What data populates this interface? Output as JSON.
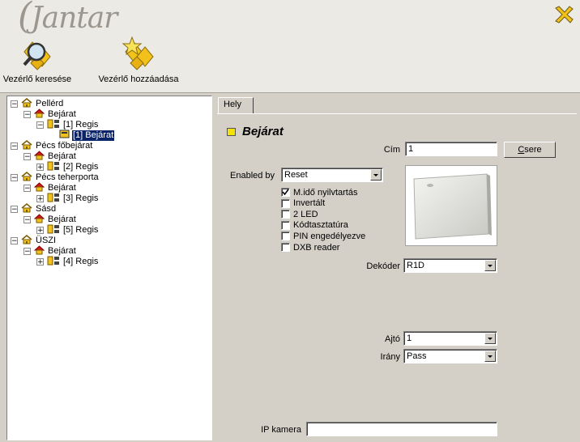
{
  "app": {
    "logo_text": "Jantar"
  },
  "toolbar": {
    "search_label": "Vezérlő keresése",
    "add_label": "Vezérlő hozzáadása"
  },
  "tree": [
    {
      "label": "Pellérd",
      "type": "site",
      "level": 0,
      "expander": "−"
    },
    {
      "label": "Bejárat",
      "type": "home",
      "level": 1,
      "expander": "−"
    },
    {
      "label": "[1] Regis",
      "type": "controller",
      "level": 2,
      "expander": "−"
    },
    {
      "label": "[1] Bejárat",
      "type": "reader",
      "level": 3,
      "expander": "",
      "selected": true
    },
    {
      "label": "Pécs főbejárat",
      "type": "site",
      "level": 0,
      "expander": "−"
    },
    {
      "label": "Bejárat",
      "type": "home",
      "level": 1,
      "expander": "−"
    },
    {
      "label": "[2] Regis",
      "type": "controller",
      "level": 2,
      "expander": "+"
    },
    {
      "label": "Pécs teherporta",
      "type": "site",
      "level": 0,
      "expander": "−"
    },
    {
      "label": "Bejárat",
      "type": "home",
      "level": 1,
      "expander": "−"
    },
    {
      "label": "[3] Regis",
      "type": "controller",
      "level": 2,
      "expander": "+"
    },
    {
      "label": "Sásd",
      "type": "site",
      "level": 0,
      "expander": "−"
    },
    {
      "label": "Bejárat",
      "type": "home",
      "level": 1,
      "expander": "−"
    },
    {
      "label": "[5] Regis",
      "type": "controller",
      "level": 2,
      "expander": "+"
    },
    {
      "label": "ÜSZI",
      "type": "site",
      "level": 0,
      "expander": "−"
    },
    {
      "label": "Bejárat",
      "type": "home",
      "level": 1,
      "expander": "−"
    },
    {
      "label": "[4] Regis",
      "type": "controller",
      "level": 2,
      "expander": "+"
    }
  ],
  "tabs": {
    "hely": "Hely"
  },
  "detail": {
    "title": "Bejárat",
    "cim_label": "Cím",
    "cim_value": "1",
    "csere_label_first": "C",
    "csere_label_rest": "sere",
    "enabled_by_label": "Enabled by",
    "enabled_by_value": "Reset",
    "checkboxes": [
      {
        "label": "M.idő nyilvtartás",
        "checked": true
      },
      {
        "label": "Invertált",
        "checked": false
      },
      {
        "label": "2 LED",
        "checked": false
      },
      {
        "label": "Kódtasztatúra",
        "checked": false
      },
      {
        "label": "PIN engedélyezve",
        "checked": false
      },
      {
        "label": "DXB reader",
        "checked": false
      }
    ],
    "dekoder_label": "Dekóder",
    "dekoder_value": "R1D",
    "ajto_label": "Ajtó",
    "ajto_value": "1",
    "irany_label": "Irány",
    "irany_value": "Pass",
    "ip_kamera_label": "IP kamera",
    "ip_kamera_value": ""
  },
  "colors": {
    "selection": "#0a246a",
    "accent_yellow": "#f6e200",
    "panel": "#d4d0c8"
  }
}
